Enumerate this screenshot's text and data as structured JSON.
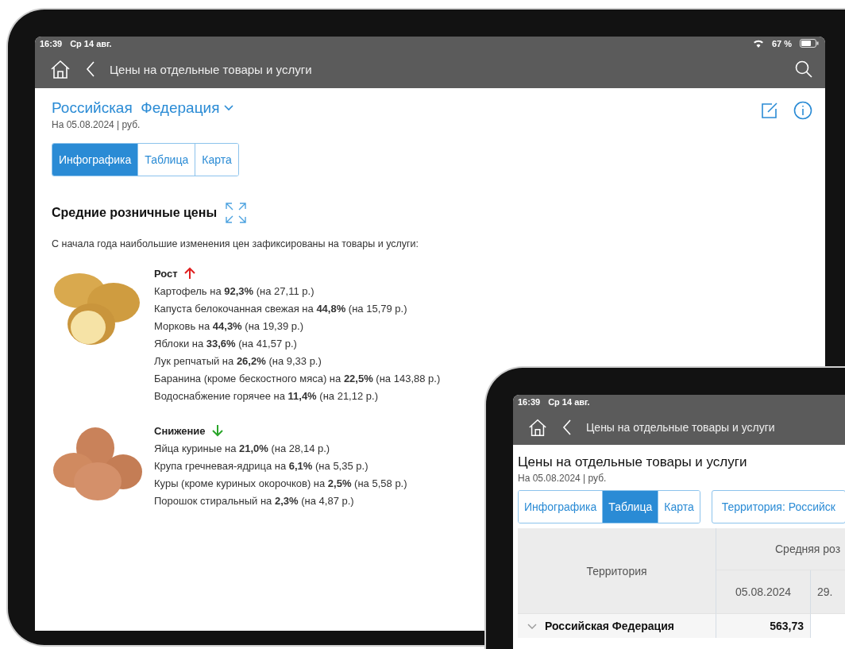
{
  "main_tablet": {
    "status_bar": {
      "time": "16:39",
      "date": "Ср 14 авг.",
      "battery": "67 %"
    },
    "nav": {
      "title": "Цены на отдельные товары и услуги"
    },
    "region": "Российская  Федерация",
    "subtitle": "На 05.08.2024 | руб.",
    "tabs": [
      {
        "label": "Инфографика",
        "selected": true
      },
      {
        "label": "Таблица",
        "selected": false
      },
      {
        "label": "Карта",
        "selected": false
      }
    ],
    "section": {
      "title": "Средние розничные цены",
      "intro": "С начала года наибольшие изменения цен зафиксированы на товары и услуги:",
      "groups": [
        {
          "kind": "rise",
          "label": "Рост",
          "items": [
            "Картофель на **92,3%** (на 27,11 р.)",
            "Капуста белокочанная свежая на **44,8%** (на 15,79 р.)",
            "Морковь на **44,3%** (на 19,39 р.)",
            "Яблоки на **33,6%** (на 41,57 р.)",
            "Лук репчатый на **26,2%** (на 9,33 р.)",
            "Баранина (кроме бескостного мяса) на **22,5%** (на 143,88 р.)",
            "Водоснабжение горячее на **11,4%** (на 21,12 р.)"
          ]
        },
        {
          "kind": "fall",
          "label": "Снижение",
          "items": [
            "Яйца куриные на **21,0%** (на 28,14 р.)",
            "Крупа гречневая-ядрица на **6,1%** (на 5,35 р.)",
            "Куры (кроме куриных окорочков) на **2,5%** (на 5,58 р.)",
            "Порошок стиральный на **2,3%** (на 4,87 р.)"
          ]
        }
      ]
    }
  },
  "second_tablet": {
    "status_bar": {
      "time": "16:39",
      "date": "Ср 14 авг."
    },
    "nav": {
      "title": "Цены на отдельные товары и услуги"
    },
    "heading": "Цены на отдельные товары и услуги",
    "subtitle": "На 05.08.2024 | руб.",
    "tabs": [
      {
        "label": "Инфографика",
        "selected": false
      },
      {
        "label": "Таблица",
        "selected": true
      },
      {
        "label": "Карта",
        "selected": false
      }
    ],
    "filter_button": "Территория: Российск",
    "table": {
      "territory_header": "Территория",
      "group_header": "Средняя роз",
      "date_headers": [
        "05.08.2024",
        "29."
      ],
      "rows": [
        {
          "name": "Российская Федерация",
          "expanded": true,
          "values": [
            "563,73"
          ]
        }
      ]
    }
  }
}
